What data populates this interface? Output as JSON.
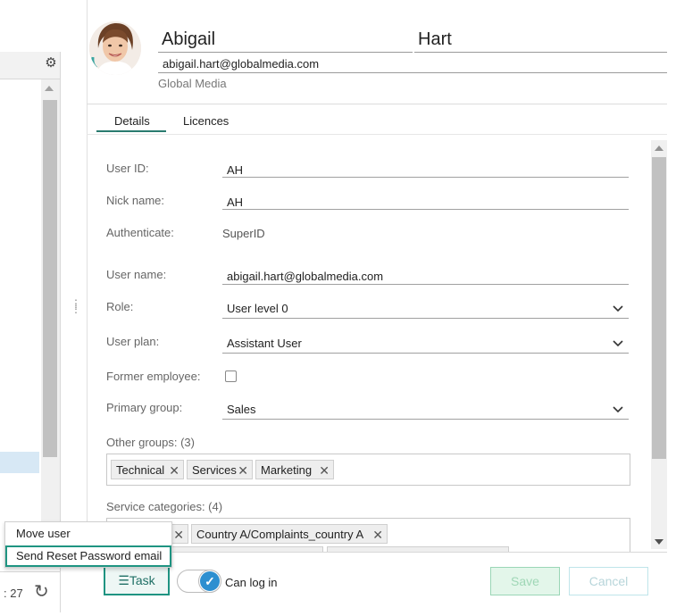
{
  "user": {
    "first_name": "Abigail",
    "last_name": "Hart",
    "email": "abigail.hart@globalmedia.com",
    "company": "Global Media"
  },
  "tabs": [
    {
      "label": "Details",
      "active": true
    },
    {
      "label": "Licences",
      "active": false
    }
  ],
  "form": {
    "user_id": {
      "label": "User ID:",
      "value": "AH"
    },
    "nick_name": {
      "label": "Nick name:",
      "value": "AH"
    },
    "authenticate": {
      "label": "Authenticate:",
      "value": "SuperID"
    },
    "user_name": {
      "label": "User name:",
      "value": "abigail.hart@globalmedia.com"
    },
    "role": {
      "label": "Role:",
      "value": "User level 0"
    },
    "user_plan": {
      "label": "User plan:",
      "value": "Assistant User"
    },
    "former_employee": {
      "label": "Former employee:",
      "checked": false
    },
    "primary_group": {
      "label": "Primary group:",
      "value": "Sales"
    },
    "other_groups": {
      "label": "Other groups: (3)",
      "tags": [
        "Technical",
        "Services",
        "Marketing"
      ]
    },
    "service_categories": {
      "label": "Service categories: (4)",
      "tags": [
        "Country A/Complaints_country A"
      ]
    }
  },
  "context_menu": {
    "items": [
      {
        "label": "Move user",
        "selected": false
      },
      {
        "label": "Send Reset Password email",
        "selected": true
      }
    ]
  },
  "left_panel": {
    "count_text": ": 27"
  },
  "footer": {
    "task_label": "Task",
    "can_log_in_label": "Can log in",
    "can_log_in": true,
    "save_label": "Save",
    "cancel_label": "Cancel"
  },
  "colors": {
    "accent": "#1f9482",
    "toggle_on": "#2d8fd0",
    "save_disabled": "#e3f6ea"
  }
}
